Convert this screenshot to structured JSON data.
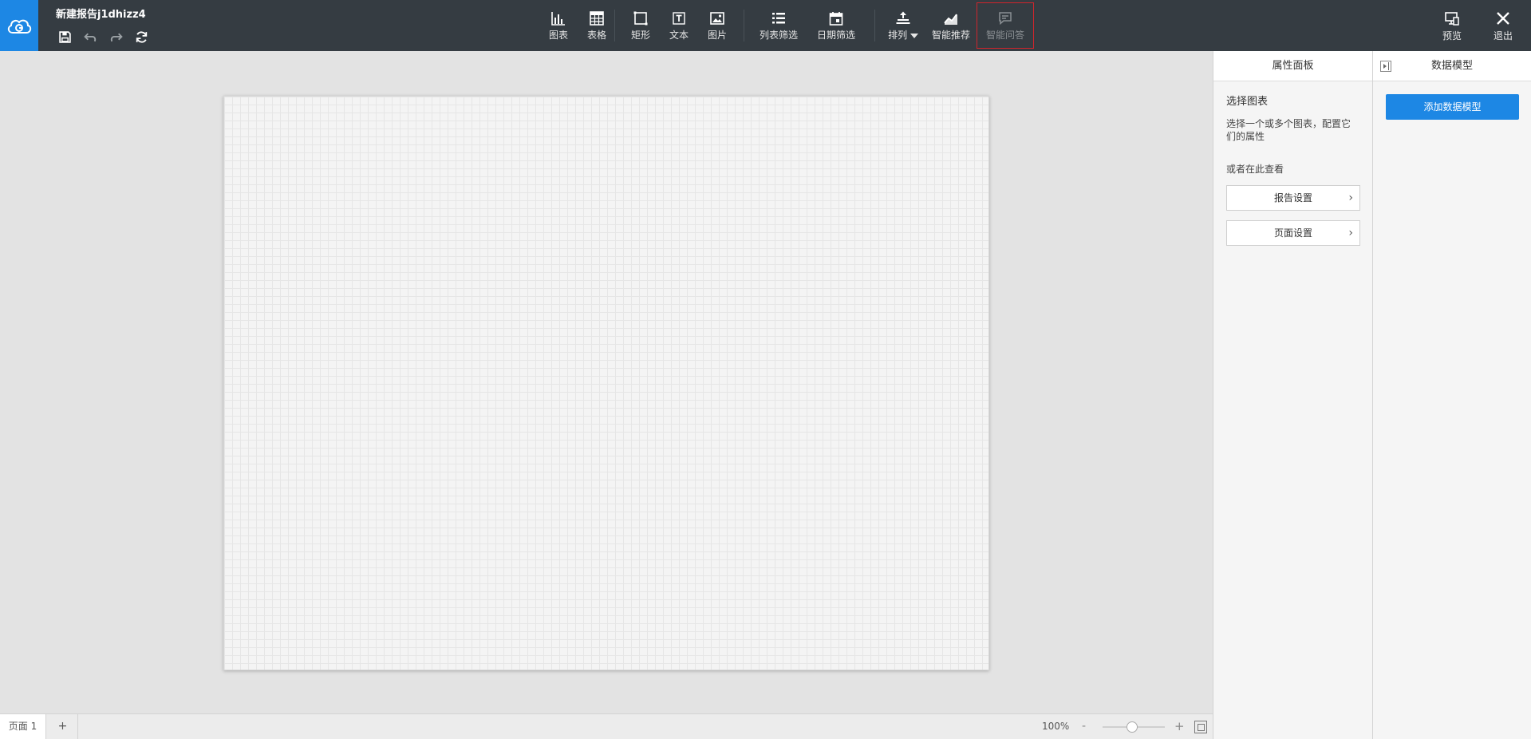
{
  "header": {
    "report_title": "新建报告j1dhizz4",
    "quick_tools": [
      "save-icon",
      "undo-icon",
      "redo-icon",
      "refresh-icon"
    ]
  },
  "toolbar": {
    "chart": "图表",
    "table": "表格",
    "rect": "矩形",
    "text": "文本",
    "image": "图片",
    "list_filter": "列表筛选",
    "date_filter": "日期筛选",
    "arrange": "排列",
    "smart_recommend": "智能推荐",
    "smart_qa": "智能问答",
    "preview": "预览",
    "exit": "退出"
  },
  "properties_panel": {
    "header": "属性面板",
    "title": "选择图表",
    "description": "选择一个或多个图表，配置它们的属性",
    "or_view": "或者在此查看",
    "report_settings": "报告设置",
    "page_settings": "页面设置"
  },
  "data_model_panel": {
    "header": "数据模型",
    "add_button": "添加数据模型"
  },
  "footer": {
    "page_tab": "页面 1",
    "add_page": "+",
    "zoom": "100%",
    "zoom_out": "-",
    "zoom_in": "+"
  },
  "colors": {
    "topbar": "#353c42",
    "accent": "#1d87e4",
    "highlight_border": "#d0252c"
  }
}
